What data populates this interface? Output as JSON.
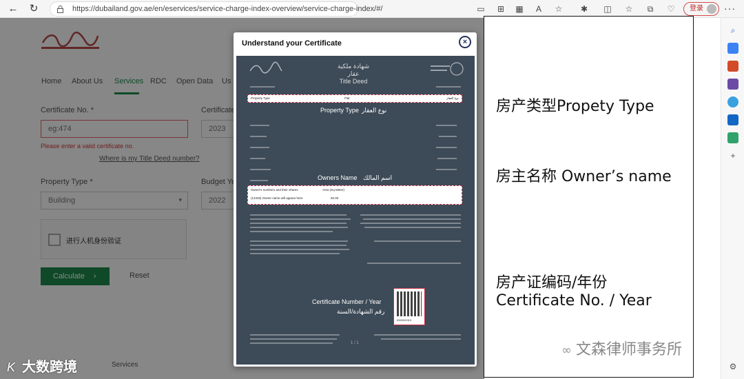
{
  "browser": {
    "url": "https://dubailand.gov.ae/en/eservices/service-charge-index-overview/service-charge-index/#/",
    "login_label": "登录",
    "more_label": "···"
  },
  "page": {
    "nav": [
      "Home",
      "About Us",
      "Services",
      "RDC",
      "Open Data",
      "Us"
    ],
    "active_nav": "Services",
    "certificate_no_label": "Certificate No. *",
    "certificate_no_placeholder": "eg:474",
    "certificate_no_error": "Please enter a valid certificate no.",
    "certificate_year_label": "Certificate",
    "certificate_year_value": "2023",
    "title_deed_link": "Where is my Title Deed number?",
    "property_type_label": "Property Type *",
    "property_type_value": "Building",
    "budget_year_label": "Budget Ye",
    "budget_year_value": "2022",
    "captcha_text": "进行人机身份验证",
    "calculate_label": "Calculate",
    "reset_label": "Reset",
    "footer_link": "Services"
  },
  "modal": {
    "title": "Understand your Certificate",
    "cert_heading_ar": "شهادة ملكية عقار",
    "cert_heading_en": "Title Deed",
    "property_type_en": "Property Type",
    "property_type_ar": "نوع العقار",
    "owners_name_en": "Owners Name",
    "owners_name_ar": "اسم المالك",
    "certificate_number_en": "Certificate Number / Year",
    "certificate_number_ar": "رقم الشهادة/السنة",
    "band1_left": "Property Type",
    "band1_mid": "Flat",
    "band1_right": "نوع العقار",
    "band2_left": "Owner's numbers and their shares",
    "band2_mid": "Area (Sq Meter)",
    "band2_row": "(12345) Owner name will appear here",
    "band2_val": "50.00",
    "qr_number": "00000/2019",
    "page_mark": "1 / 1"
  },
  "annotations": {
    "property_type": "房产类型Propety Type",
    "owners_name": "房主名称 Owner’s name",
    "certificate_line1": "房产证编码/年份",
    "certificate_line2": "Certificate No.  / Year"
  },
  "watermarks": {
    "left_logo": "K",
    "left_text": "大数跨境",
    "right_text": "文森律师事务所"
  },
  "colors": {
    "brand_green": "#1e8a4c",
    "cert_bg": "#3d4a57",
    "highlight_red": "#c8334a"
  }
}
